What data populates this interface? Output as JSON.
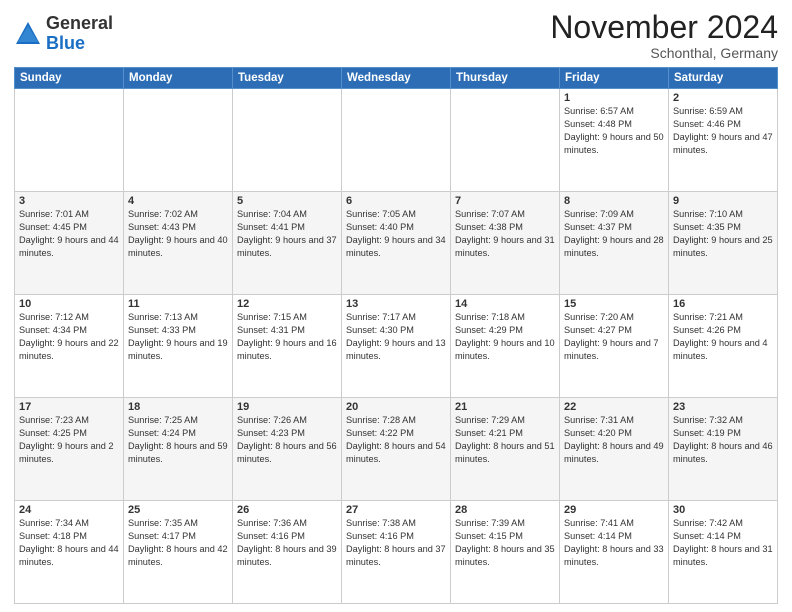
{
  "header": {
    "logo_general": "General",
    "logo_blue": "Blue",
    "month_title": "November 2024",
    "location": "Schonthal, Germany"
  },
  "days_of_week": [
    "Sunday",
    "Monday",
    "Tuesday",
    "Wednesday",
    "Thursday",
    "Friday",
    "Saturday"
  ],
  "weeks": [
    [
      {
        "day": "",
        "info": ""
      },
      {
        "day": "",
        "info": ""
      },
      {
        "day": "",
        "info": ""
      },
      {
        "day": "",
        "info": ""
      },
      {
        "day": "",
        "info": ""
      },
      {
        "day": "1",
        "info": "Sunrise: 6:57 AM\nSunset: 4:48 PM\nDaylight: 9 hours and 50 minutes."
      },
      {
        "day": "2",
        "info": "Sunrise: 6:59 AM\nSunset: 4:46 PM\nDaylight: 9 hours and 47 minutes."
      }
    ],
    [
      {
        "day": "3",
        "info": "Sunrise: 7:01 AM\nSunset: 4:45 PM\nDaylight: 9 hours and 44 minutes."
      },
      {
        "day": "4",
        "info": "Sunrise: 7:02 AM\nSunset: 4:43 PM\nDaylight: 9 hours and 40 minutes."
      },
      {
        "day": "5",
        "info": "Sunrise: 7:04 AM\nSunset: 4:41 PM\nDaylight: 9 hours and 37 minutes."
      },
      {
        "day": "6",
        "info": "Sunrise: 7:05 AM\nSunset: 4:40 PM\nDaylight: 9 hours and 34 minutes."
      },
      {
        "day": "7",
        "info": "Sunrise: 7:07 AM\nSunset: 4:38 PM\nDaylight: 9 hours and 31 minutes."
      },
      {
        "day": "8",
        "info": "Sunrise: 7:09 AM\nSunset: 4:37 PM\nDaylight: 9 hours and 28 minutes."
      },
      {
        "day": "9",
        "info": "Sunrise: 7:10 AM\nSunset: 4:35 PM\nDaylight: 9 hours and 25 minutes."
      }
    ],
    [
      {
        "day": "10",
        "info": "Sunrise: 7:12 AM\nSunset: 4:34 PM\nDaylight: 9 hours and 22 minutes."
      },
      {
        "day": "11",
        "info": "Sunrise: 7:13 AM\nSunset: 4:33 PM\nDaylight: 9 hours and 19 minutes."
      },
      {
        "day": "12",
        "info": "Sunrise: 7:15 AM\nSunset: 4:31 PM\nDaylight: 9 hours and 16 minutes."
      },
      {
        "day": "13",
        "info": "Sunrise: 7:17 AM\nSunset: 4:30 PM\nDaylight: 9 hours and 13 minutes."
      },
      {
        "day": "14",
        "info": "Sunrise: 7:18 AM\nSunset: 4:29 PM\nDaylight: 9 hours and 10 minutes."
      },
      {
        "day": "15",
        "info": "Sunrise: 7:20 AM\nSunset: 4:27 PM\nDaylight: 9 hours and 7 minutes."
      },
      {
        "day": "16",
        "info": "Sunrise: 7:21 AM\nSunset: 4:26 PM\nDaylight: 9 hours and 4 minutes."
      }
    ],
    [
      {
        "day": "17",
        "info": "Sunrise: 7:23 AM\nSunset: 4:25 PM\nDaylight: 9 hours and 2 minutes."
      },
      {
        "day": "18",
        "info": "Sunrise: 7:25 AM\nSunset: 4:24 PM\nDaylight: 8 hours and 59 minutes."
      },
      {
        "day": "19",
        "info": "Sunrise: 7:26 AM\nSunset: 4:23 PM\nDaylight: 8 hours and 56 minutes."
      },
      {
        "day": "20",
        "info": "Sunrise: 7:28 AM\nSunset: 4:22 PM\nDaylight: 8 hours and 54 minutes."
      },
      {
        "day": "21",
        "info": "Sunrise: 7:29 AM\nSunset: 4:21 PM\nDaylight: 8 hours and 51 minutes."
      },
      {
        "day": "22",
        "info": "Sunrise: 7:31 AM\nSunset: 4:20 PM\nDaylight: 8 hours and 49 minutes."
      },
      {
        "day": "23",
        "info": "Sunrise: 7:32 AM\nSunset: 4:19 PM\nDaylight: 8 hours and 46 minutes."
      }
    ],
    [
      {
        "day": "24",
        "info": "Sunrise: 7:34 AM\nSunset: 4:18 PM\nDaylight: 8 hours and 44 minutes."
      },
      {
        "day": "25",
        "info": "Sunrise: 7:35 AM\nSunset: 4:17 PM\nDaylight: 8 hours and 42 minutes."
      },
      {
        "day": "26",
        "info": "Sunrise: 7:36 AM\nSunset: 4:16 PM\nDaylight: 8 hours and 39 minutes."
      },
      {
        "day": "27",
        "info": "Sunrise: 7:38 AM\nSunset: 4:16 PM\nDaylight: 8 hours and 37 minutes."
      },
      {
        "day": "28",
        "info": "Sunrise: 7:39 AM\nSunset: 4:15 PM\nDaylight: 8 hours and 35 minutes."
      },
      {
        "day": "29",
        "info": "Sunrise: 7:41 AM\nSunset: 4:14 PM\nDaylight: 8 hours and 33 minutes."
      },
      {
        "day": "30",
        "info": "Sunrise: 7:42 AM\nSunset: 4:14 PM\nDaylight: 8 hours and 31 minutes."
      }
    ]
  ]
}
